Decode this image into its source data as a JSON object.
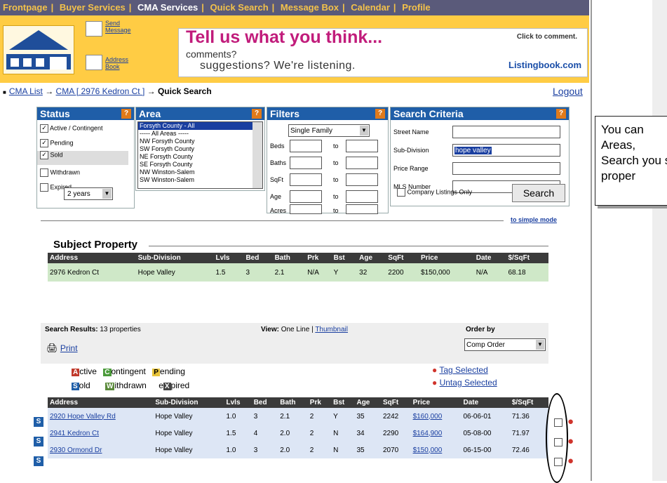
{
  "nav": {
    "items": [
      "Frontpage",
      "Buyer Services",
      "CMA Services",
      "Quick Search",
      "Message Box",
      "Calendar",
      "Profile"
    ]
  },
  "banner": {
    "send_message": "Send Message",
    "address_book": "Address Book",
    "ad_title": "Tell us what you think...",
    "ad_line1": "comments?",
    "ad_line2": "suggestions?  We're listening.",
    "ad_click": "Click to comment.",
    "ad_brand": "Listingbook.com"
  },
  "breadcrumb": {
    "cma_list": "CMA List",
    "cma": "CMA [ 2976 Kedron Ct ]",
    "current": "Quick Search",
    "logout": "Logout"
  },
  "status": {
    "title": "Status",
    "options": [
      {
        "label": "Active / Contingent",
        "checked": true
      },
      {
        "label": "Pending",
        "checked": true
      },
      {
        "label": "Sold",
        "checked": true
      },
      {
        "label": "Withdrawn",
        "checked": false
      },
      {
        "label": "Expired",
        "checked": false
      }
    ],
    "period": "2 years"
  },
  "area": {
    "title": "Area",
    "options": [
      "Forsyth County - All",
      "----- All Areas -----",
      "NW Forsyth County",
      "SW Forsyth County",
      "NE Forsyth County",
      "SE Forsyth County",
      "NW Winston-Salem",
      "SW Winston-Salem"
    ]
  },
  "filters": {
    "title": "Filters",
    "type": "Single Family",
    "labels": [
      "Beds",
      "Baths",
      "SqFt",
      "Age",
      "Acres"
    ],
    "to": "to"
  },
  "criteria": {
    "title": "Search Criteria",
    "street_label": "Street Name",
    "subdivision_label": "Sub-Division",
    "subdivision_value": "hope valley",
    "price_label": "Price Range",
    "mls_label": "MLS Number",
    "company_only": "Company Listings Only",
    "search_button": "Search"
  },
  "simple_mode": "to simple mode",
  "subject": {
    "title": "Subject Property",
    "headers": [
      "Address",
      "Sub-Division",
      "Lvls",
      "Bed",
      "Bath",
      "Prk",
      "Bst",
      "Age",
      "SqFt",
      "Price",
      "Date",
      "$/SqFt"
    ],
    "row": [
      "2976 Kedron Ct",
      "Hope Valley",
      "1.5",
      "3",
      "2.1",
      "N/A",
      "Y",
      "32",
      "2200",
      "$150,000",
      "N/A",
      "68.18"
    ]
  },
  "results_bar": {
    "label": "Search Results:",
    "count": "13 properties",
    "view_label": "View:",
    "view_one": "One Line",
    "view_sep": "|",
    "view_thumb": "Thumbnail",
    "order_label": "Order by",
    "order_value": "Comp Order",
    "print": "Print"
  },
  "legend": {
    "active": "ctive",
    "contingent": "ontingent",
    "pending": "ending",
    "sold": "old",
    "withdrawn": "ithdrawn",
    "expired_pre": "e",
    "expired_post": "pired",
    "a": "A",
    "c": "C",
    "p": "P",
    "s": "S",
    "w": "W",
    "x": "X"
  },
  "tag_selected": "Tag Selected",
  "untag_selected": "Untag Selected",
  "results": {
    "headers": [
      "Address",
      "Sub-Division",
      "Lvls",
      "Bed",
      "Bath",
      "Prk",
      "Bst",
      "Age",
      "SqFt",
      "Price",
      "Date",
      "$/SqFt"
    ],
    "rows": [
      [
        "2920 Hope Valley Rd",
        "Hope Valley",
        "1.0",
        "3",
        "2.1",
        "2",
        "Y",
        "35",
        "2242",
        "$160,000",
        "06-06-01",
        "71.36"
      ],
      [
        "2941 Kedron Ct",
        "Hope Valley",
        "1.5",
        "4",
        "2.0",
        "2",
        "N",
        "34",
        "2290",
        "$164,900",
        "05-08-00",
        "71.97"
      ],
      [
        "2930 Ormond Dr",
        "Hope Valley",
        "1.0",
        "3",
        "2.0",
        "2",
        "N",
        "35",
        "2070",
        "$150,000",
        "06-15-00",
        "72.46"
      ]
    ],
    "status_letter": "S"
  },
  "callout": {
    "text": "You can Areas, Search you s proper"
  },
  "colors": {
    "nav_bg": "#5a5a7a",
    "banner": "#ffcc44",
    "panel_head": "#1f5ea8",
    "accent": "#e07a1a"
  }
}
